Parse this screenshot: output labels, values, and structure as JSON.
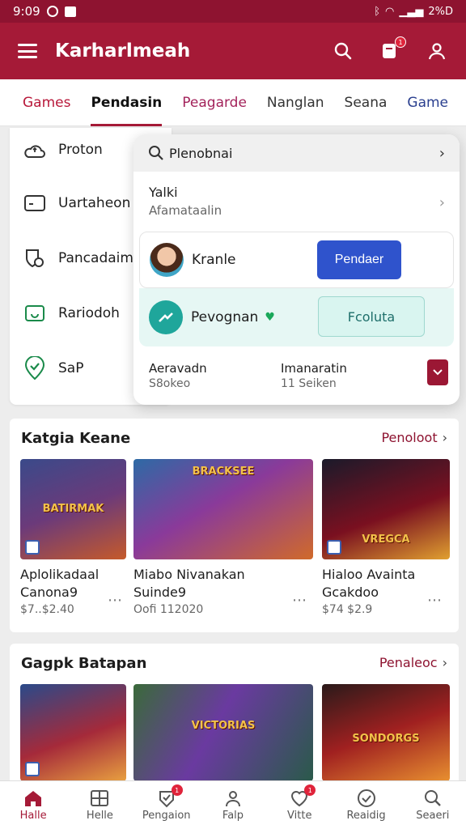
{
  "status_bar": {
    "time": "9:09",
    "right_text": "2%D"
  },
  "app_bar": {
    "title": "Karharlmeah",
    "notification_badge": "1"
  },
  "tabs": [
    {
      "label": "Games",
      "color": "#b8183a"
    },
    {
      "label": "Pendasin",
      "color": "#111111"
    },
    {
      "label": "Peagarde",
      "color": "#a3235b"
    },
    {
      "label": "Nanglan",
      "color": "#333333"
    },
    {
      "label": "Seana",
      "color": "#333333"
    },
    {
      "label": "Game",
      "color": "#2a3f8f"
    }
  ],
  "side_menu": [
    {
      "label": "Proton",
      "icon": "cloud-icon"
    },
    {
      "label": "Uartaheon",
      "icon": "id-card-icon"
    },
    {
      "label": "Pancadaim",
      "icon": "shield-icon"
    },
    {
      "label": "Rariodoh",
      "icon": "wallet-icon"
    },
    {
      "label": "SaP",
      "icon": "location-check-icon"
    }
  ],
  "dropdown": {
    "search_text": "Plenobnai",
    "title": "Yalki",
    "subtitle": "Afamataalin",
    "user": {
      "name": "Kranle",
      "button": "Pendaer"
    },
    "group": {
      "name": "Pevognan",
      "button": "Fcoluta"
    },
    "stats": [
      {
        "label": "Aeravadn",
        "value": "S8okeo"
      },
      {
        "label": "Imanaratin",
        "value": "11 Seiken"
      }
    ]
  },
  "section1": {
    "title": "Katgia Keane",
    "more": "Penoloot",
    "cards": [
      {
        "title": "Aplolikadaal Canona9",
        "price": "$7..$2.40",
        "art": "BATIRMAK"
      },
      {
        "title": "Miabo Nivanakan Suinde9",
        "price": "Oofi 112020",
        "art": "BRACKSEE"
      },
      {
        "title": "Hialoo Avainta Gcakdoo",
        "price": "$74 $2.9",
        "art": "VREGCA"
      }
    ]
  },
  "section2": {
    "title": "Gagpk Batapan",
    "more": "Penaleoc",
    "cards": [
      {
        "art": ""
      },
      {
        "art": "VICTORIAS"
      },
      {
        "art": "SONDORGS"
      }
    ]
  },
  "bottom_nav": [
    {
      "label": "Halle",
      "icon": "home-icon",
      "badge": ""
    },
    {
      "label": "Helle",
      "icon": "grid-icon",
      "badge": ""
    },
    {
      "label": "Pengaion",
      "icon": "badge-icon",
      "badge": "1"
    },
    {
      "label": "Falp",
      "icon": "people-icon",
      "badge": ""
    },
    {
      "label": "Vitte",
      "icon": "heart-icon",
      "badge": "1"
    },
    {
      "label": "Reaidig",
      "icon": "check-circle-icon",
      "badge": ""
    },
    {
      "label": "Seaeri",
      "icon": "search-icon",
      "badge": ""
    }
  ],
  "colors": {
    "brand": "#a51a37",
    "primary_button": "#2f53cc",
    "mint": "#e6f7f4"
  }
}
